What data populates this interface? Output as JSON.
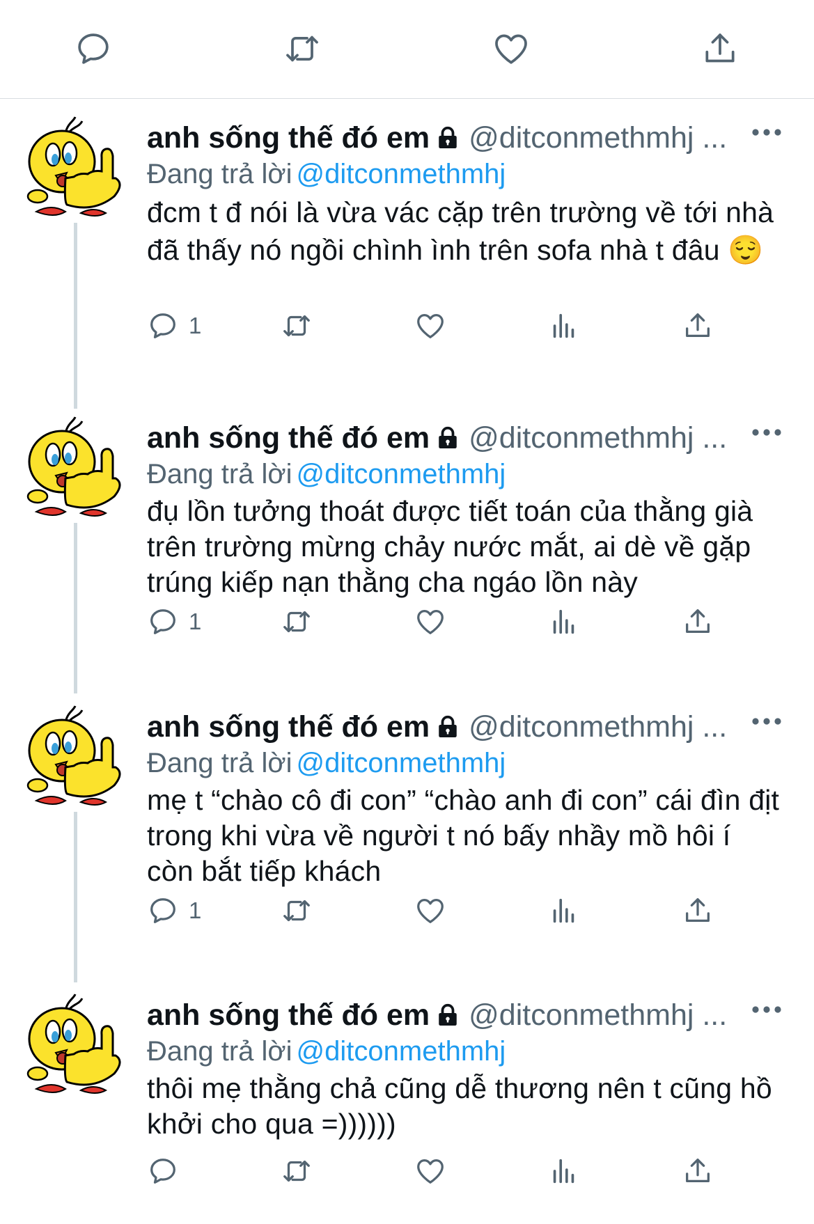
{
  "colors": {
    "accent": "#1d9bf0",
    "icon": "#536471",
    "text": "#0f1419",
    "thread": "#cfd9de"
  },
  "top_actions": [
    "reply-icon",
    "retweet-icon",
    "like-icon",
    "share-icon"
  ],
  "tweets": [
    {
      "name": "anh sống thế đó em",
      "handle": "@ditconmethmhj ...",
      "reply_label": "Đang trả lời",
      "reply_handle": "@ditconmethmhj",
      "text": "đcm t đ nói là vừa vác cặp trên trường về tới nhà đã thấy nó ngồi chình ình trên sofa nhà t đâu 😌",
      "reply_count": "1"
    },
    {
      "name": "anh sống thế đó em",
      "handle": "@ditconmethmhj ...",
      "reply_label": "Đang trả lời",
      "reply_handle": "@ditconmethmhj",
      "text": "đụ lồn tưởng thoát được tiết toán của thằng già trên trường mừng chảy nước mắt, ai dè về gặp trúng kiếp nạn thằng cha ngáo lồn này",
      "reply_count": "1"
    },
    {
      "name": "anh sống thế đó em",
      "handle": "@ditconmethmhj ...",
      "reply_label": "Đang trả lời",
      "reply_handle": "@ditconmethmhj",
      "text": "mẹ t “chào cô đi con” “chào anh đi con” cái đìn địt trong khi vừa về người t nó bấy nhầy mồ hôi í còn bắt tiếp khách",
      "reply_count": "1"
    },
    {
      "name": "anh sống thế đó em",
      "handle": "@ditconmethmhj ...",
      "reply_label": "Đang trả lời",
      "reply_handle": "@ditconmethmhj",
      "text": "thôi mẹ thằng chả cũng dễ thương nên t cũng hồ khởi cho qua =))))))",
      "reply_count": ""
    }
  ]
}
